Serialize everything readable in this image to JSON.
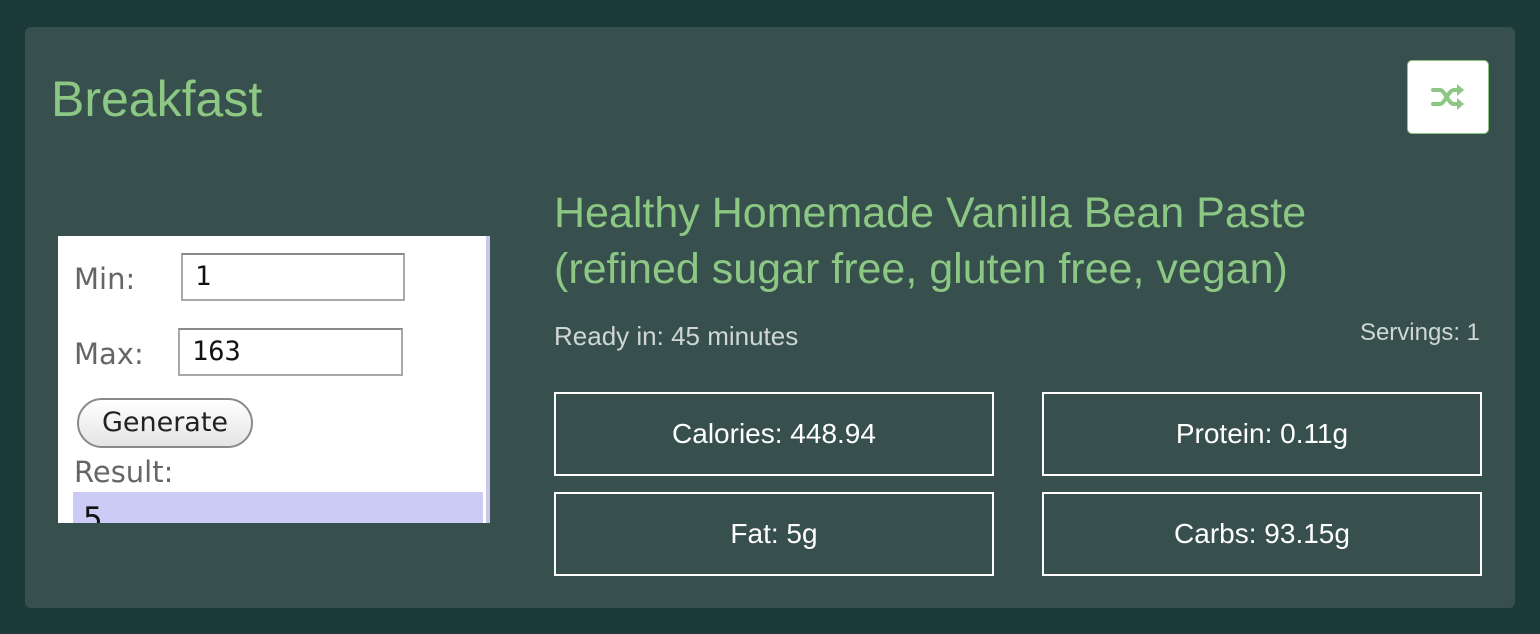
{
  "card": {
    "title": "Breakfast",
    "shuffle_icon": "shuffle-icon"
  },
  "thumbnail": {
    "min_label": "Min:",
    "min_value": "1",
    "max_label": "Max:",
    "max_value": "163",
    "generate_label": "Generate",
    "result_label": "Result:",
    "result_value": "5"
  },
  "recipe": {
    "title": "Healthy Homemade Vanilla Bean Paste (refined sugar free, gluten free, vegan)",
    "ready_in": "Ready in: 45 minutes",
    "servings": "Servings: 1"
  },
  "nutrition": {
    "calories": "Calories: 448.94",
    "protein": "Protein: 0.11g",
    "fat": "Fat: 5g",
    "carbs": "Carbs: 93.15g"
  },
  "colors": {
    "page_bg": "#1c3a3a",
    "card_bg": "#37504d",
    "accent_green": "#8cc784",
    "text_light": "#cfd6d3"
  }
}
